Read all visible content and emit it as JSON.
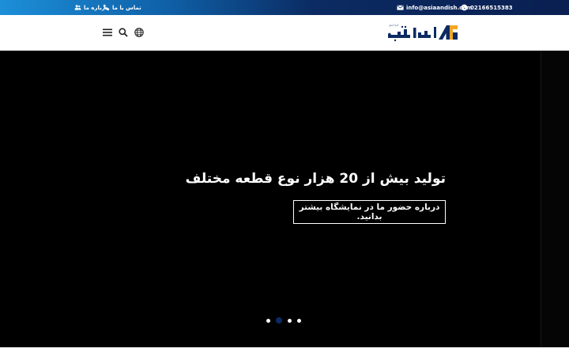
{
  "topbar": {
    "phone": "02166515383",
    "email": "info@asiaandish.com",
    "contact_label": "تماس با ما",
    "about_label": "درباره ما",
    "icons": [
      "whatsapp-icon",
      "mail-icon",
      "phone-icon",
      "users-icon"
    ]
  },
  "header": {
    "logo_text": "آسیا اندیش",
    "icons": [
      "menu-icon",
      "search-icon",
      "globe-icon"
    ]
  },
  "hero": {
    "title": "تولید بیش از 20 هزار نوع قطعه مختلف",
    "button_label": "درباره حضور ما در نمایشگاه بیشتر بدانید.",
    "slides_count": 4,
    "active_slide": 2
  },
  "colors": {
    "topbar_start": "#1c8fd8",
    "topbar_end": "#0a1f52",
    "brand_navy": "#0b2b62",
    "brand_orange": "#f5a623",
    "hero_bg": "#000000"
  }
}
